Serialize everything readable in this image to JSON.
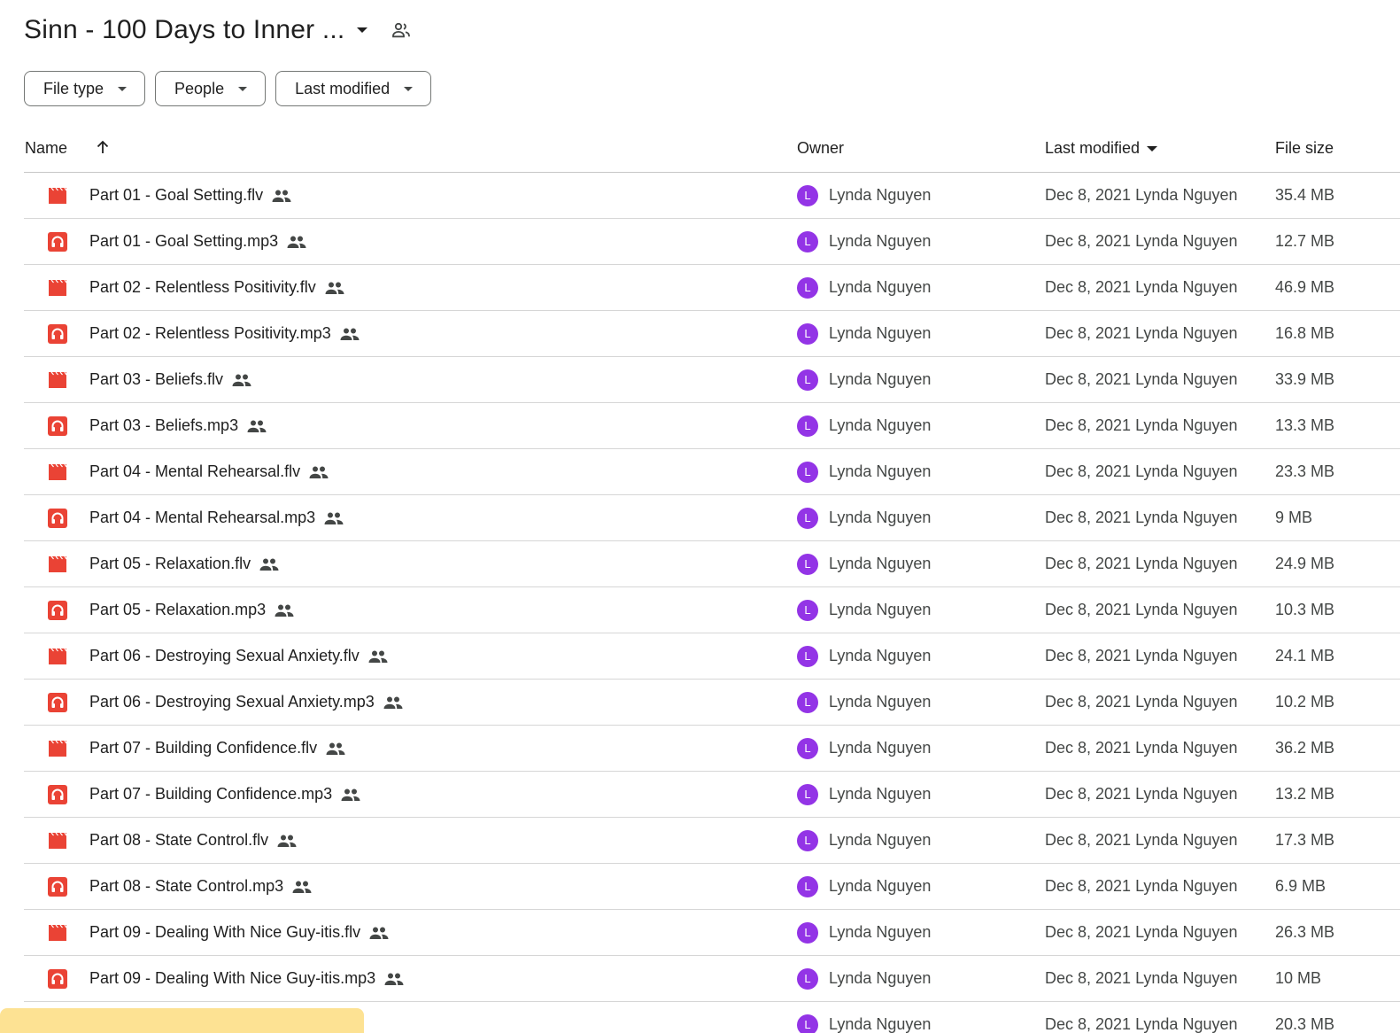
{
  "folder": {
    "title": "Sinn - 100 Days to Inner ...",
    "title_icon": "chevron-down-icon",
    "shared_icon": "people-icon"
  },
  "filters": [
    {
      "label": "File type"
    },
    {
      "label": "People"
    },
    {
      "label": "Last modified"
    }
  ],
  "columns": {
    "name": "Name",
    "sort_icon": "arrow-up-icon",
    "owner": "Owner",
    "last_modified": "Last modified",
    "file_size": "File size"
  },
  "colors": {
    "file_icon": "#ea4335",
    "avatar": "#9334e6",
    "toast": "#fde293"
  },
  "files": [
    {
      "name": "Part 01 - Goal Setting.flv",
      "type": "video",
      "owner": "Lynda Nguyen",
      "avatar_initial": "L",
      "modified": "Dec 8, 2021 Lynda Nguyen",
      "size": "35.4 MB"
    },
    {
      "name": "Part 01 - Goal Setting.mp3",
      "type": "audio",
      "owner": "Lynda Nguyen",
      "avatar_initial": "L",
      "modified": "Dec 8, 2021 Lynda Nguyen",
      "size": "12.7 MB"
    },
    {
      "name": "Part 02 - Relentless Positivity.flv",
      "type": "video",
      "owner": "Lynda Nguyen",
      "avatar_initial": "L",
      "modified": "Dec 8, 2021 Lynda Nguyen",
      "size": "46.9 MB"
    },
    {
      "name": "Part 02 - Relentless Positivity.mp3",
      "type": "audio",
      "owner": "Lynda Nguyen",
      "avatar_initial": "L",
      "modified": "Dec 8, 2021 Lynda Nguyen",
      "size": "16.8 MB"
    },
    {
      "name": "Part 03 - Beliefs.flv",
      "type": "video",
      "owner": "Lynda Nguyen",
      "avatar_initial": "L",
      "modified": "Dec 8, 2021 Lynda Nguyen",
      "size": "33.9 MB"
    },
    {
      "name": "Part 03 - Beliefs.mp3",
      "type": "audio",
      "owner": "Lynda Nguyen",
      "avatar_initial": "L",
      "modified": "Dec 8, 2021 Lynda Nguyen",
      "size": "13.3 MB"
    },
    {
      "name": "Part 04 - Mental Rehearsal.flv",
      "type": "video",
      "owner": "Lynda Nguyen",
      "avatar_initial": "L",
      "modified": "Dec 8, 2021 Lynda Nguyen",
      "size": "23.3 MB"
    },
    {
      "name": "Part 04 - Mental Rehearsal.mp3",
      "type": "audio",
      "owner": "Lynda Nguyen",
      "avatar_initial": "L",
      "modified": "Dec 8, 2021 Lynda Nguyen",
      "size": "9 MB"
    },
    {
      "name": "Part 05 - Relaxation.flv",
      "type": "video",
      "owner": "Lynda Nguyen",
      "avatar_initial": "L",
      "modified": "Dec 8, 2021 Lynda Nguyen",
      "size": "24.9 MB"
    },
    {
      "name": "Part 05 - Relaxation.mp3",
      "type": "audio",
      "owner": "Lynda Nguyen",
      "avatar_initial": "L",
      "modified": "Dec 8, 2021 Lynda Nguyen",
      "size": "10.3 MB"
    },
    {
      "name": "Part 06 - Destroying Sexual Anxiety.flv",
      "type": "video",
      "owner": "Lynda Nguyen",
      "avatar_initial": "L",
      "modified": "Dec 8, 2021 Lynda Nguyen",
      "size": "24.1 MB"
    },
    {
      "name": "Part 06 - Destroying Sexual Anxiety.mp3",
      "type": "audio",
      "owner": "Lynda Nguyen",
      "avatar_initial": "L",
      "modified": "Dec 8, 2021 Lynda Nguyen",
      "size": "10.2 MB"
    },
    {
      "name": "Part 07 - Building Confidence.flv",
      "type": "video",
      "owner": "Lynda Nguyen",
      "avatar_initial": "L",
      "modified": "Dec 8, 2021 Lynda Nguyen",
      "size": "36.2 MB"
    },
    {
      "name": "Part 07 - Building Confidence.mp3",
      "type": "audio",
      "owner": "Lynda Nguyen",
      "avatar_initial": "L",
      "modified": "Dec 8, 2021 Lynda Nguyen",
      "size": "13.2 MB"
    },
    {
      "name": "Part 08 - State Control.flv",
      "type": "video",
      "owner": "Lynda Nguyen",
      "avatar_initial": "L",
      "modified": "Dec 8, 2021 Lynda Nguyen",
      "size": "17.3 MB"
    },
    {
      "name": "Part 08 - State Control.mp3",
      "type": "audio",
      "owner": "Lynda Nguyen",
      "avatar_initial": "L",
      "modified": "Dec 8, 2021 Lynda Nguyen",
      "size": "6.9 MB"
    },
    {
      "name": "Part 09 - Dealing With Nice Guy-itis.flv",
      "type": "video",
      "owner": "Lynda Nguyen",
      "avatar_initial": "L",
      "modified": "Dec 8, 2021 Lynda Nguyen",
      "size": "26.3 MB"
    },
    {
      "name": "Part 09 - Dealing With Nice Guy-itis.mp3",
      "type": "audio",
      "owner": "Lynda Nguyen",
      "avatar_initial": "L",
      "modified": "Dec 8, 2021 Lynda Nguyen",
      "size": "10 MB"
    },
    {
      "name": "",
      "type": "video",
      "owner": "Lynda Nguyen",
      "avatar_initial": "L",
      "modified": "Dec 8, 2021 Lynda Nguyen",
      "size": "20.3 MB"
    }
  ]
}
